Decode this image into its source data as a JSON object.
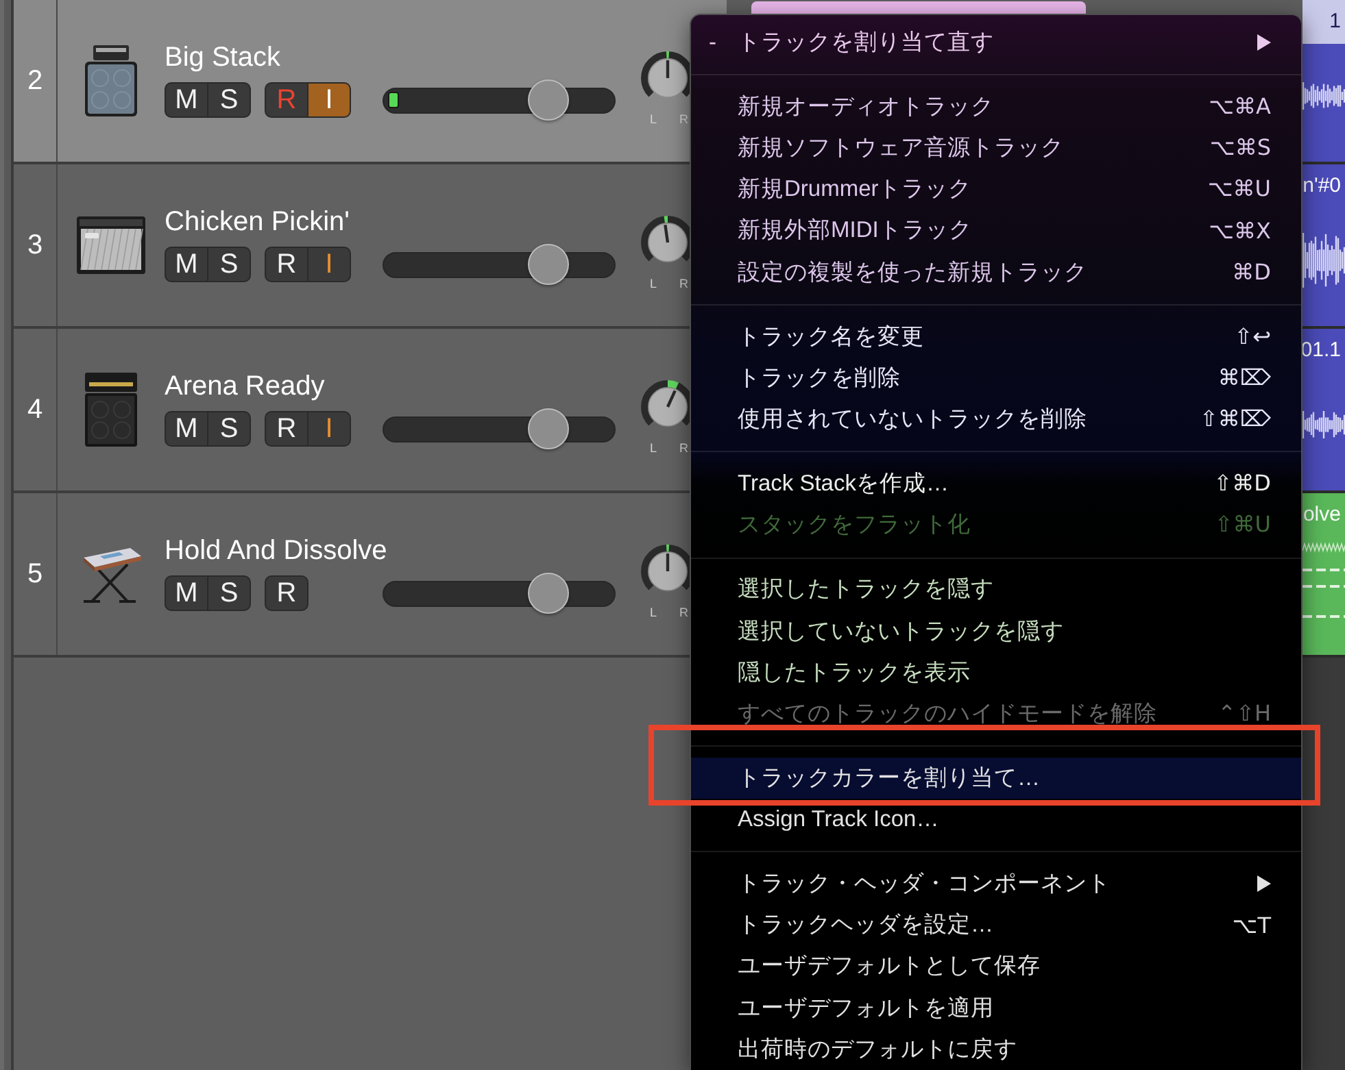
{
  "tracks": [
    {
      "number": "2",
      "name": "Big Stack",
      "kind": "stack",
      "selected": true,
      "button_groups": [
        [
          {
            "label": "M",
            "kind": "mute",
            "on": false,
            "filled": false
          },
          {
            "label": "S",
            "kind": "solo",
            "on": false,
            "filled": false
          }
        ],
        [
          {
            "label": "R",
            "kind": "record",
            "on": true,
            "filled": false
          },
          {
            "label": "I",
            "kind": "input",
            "on": true,
            "filled": true
          }
        ]
      ],
      "meter": {
        "level": 0.05
      },
      "volume": {
        "level": 0.76
      },
      "pan": {
        "level": 0.5,
        "left_label": "L",
        "right_label": "R"
      },
      "regions": [
        {
          "kind": "plain",
          "color": "#e9b6ea",
          "selected": false
        },
        {
          "kind": "audio",
          "color": "#4b4bb9",
          "selected": true,
          "title": "1"
        }
      ]
    },
    {
      "number": "3",
      "name": "Chicken Pickin'",
      "kind": "combo",
      "selected": false,
      "button_groups": [
        [
          {
            "label": "M",
            "kind": "mute",
            "on": false,
            "filled": false
          },
          {
            "label": "S",
            "kind": "solo",
            "on": false,
            "filled": false
          }
        ],
        [
          {
            "label": "R",
            "kind": "record",
            "on": false,
            "filled": false
          },
          {
            "label": "I",
            "kind": "input",
            "on": true,
            "filled": false
          }
        ]
      ],
      "volume": {
        "level": 0.76
      },
      "pan": {
        "level": 0.47,
        "left_label": "L",
        "right_label": "R"
      },
      "regions": [
        {
          "kind": "audio",
          "color": "#4b4bb9",
          "selected": false,
          "title": "n'#0"
        }
      ]
    },
    {
      "number": "4",
      "name": "Arena Ready",
      "kind": "fullstack",
      "selected": false,
      "button_groups": [
        [
          {
            "label": "M",
            "kind": "mute",
            "on": false,
            "filled": false
          },
          {
            "label": "S",
            "kind": "solo",
            "on": false,
            "filled": false
          }
        ],
        [
          {
            "label": "R",
            "kind": "record",
            "on": false,
            "filled": false
          },
          {
            "label": "I",
            "kind": "input",
            "on": true,
            "filled": false
          }
        ]
      ],
      "volume": {
        "level": 0.76
      },
      "pan": {
        "level": 0.59,
        "left_label": "L",
        "right_label": "R"
      },
      "regions": [
        {
          "kind": "audio",
          "color": "#4b4bb9",
          "selected": false,
          "title": "01.1"
        }
      ]
    },
    {
      "number": "5",
      "name": "Hold And Dissolve",
      "kind": "keyboard",
      "selected": false,
      "button_groups": [
        [
          {
            "label": "M",
            "kind": "mute",
            "on": false,
            "filled": false
          },
          {
            "label": "S",
            "kind": "solo",
            "on": false,
            "filled": false
          }
        ],
        [
          {
            "label": "R",
            "kind": "record",
            "on": false,
            "filled": false
          }
        ]
      ],
      "volume": {
        "level": 0.76
      },
      "pan": {
        "level": 0.5,
        "left_label": "L",
        "right_label": "R"
      },
      "regions": [
        {
          "kind": "midi",
          "color": "#5ab85a",
          "selected": false,
          "title": "olve"
        }
      ]
    }
  ],
  "menu": {
    "sections": [
      {
        "items": [
          {
            "label": "トラックを割り当て直す",
            "mark": "-",
            "kind": "submenu",
            "disabled": false,
            "selected": false
          }
        ]
      },
      {
        "items": [
          {
            "label": "新規オーディオトラック",
            "shortcut": "⌥⌘A",
            "kind": "command",
            "disabled": false,
            "selected": false
          },
          {
            "label": "新規ソフトウェア音源トラック",
            "shortcut": "⌥⌘S",
            "kind": "command",
            "disabled": false,
            "selected": false
          },
          {
            "label": "新規Drummerトラック",
            "shortcut": "⌥⌘U",
            "kind": "command",
            "disabled": false,
            "selected": false
          },
          {
            "label": "新規外部MIDIトラック",
            "shortcut": "⌥⌘X",
            "kind": "command",
            "disabled": false,
            "selected": false
          },
          {
            "label": "設定の複製を使った新規トラック",
            "shortcut": "⌘D",
            "kind": "command",
            "disabled": false,
            "selected": false
          }
        ]
      },
      {
        "items": [
          {
            "label": "トラック名を変更",
            "shortcut": "⇧↩",
            "kind": "command",
            "disabled": false,
            "selected": false
          },
          {
            "label": "トラックを削除",
            "shortcut": "⌘⌦",
            "kind": "command",
            "disabled": false,
            "selected": false
          },
          {
            "label": "使用されていないトラックを削除",
            "shortcut": "⇧⌘⌦",
            "kind": "command",
            "disabled": false,
            "selected": false
          }
        ]
      },
      {
        "items": [
          {
            "label": "Track Stackを作成…",
            "shortcut": "⇧⌘D",
            "kind": "command",
            "disabled": false,
            "selected": false
          },
          {
            "label": "スタックをフラット化",
            "shortcut": "⇧⌘U",
            "kind": "command",
            "disabled": true,
            "selected": false
          }
        ]
      },
      {
        "items": [
          {
            "label": "選択したトラックを隠す",
            "kind": "command",
            "disabled": false,
            "selected": false
          },
          {
            "label": "選択していないトラックを隠す",
            "kind": "command",
            "disabled": false,
            "selected": false
          },
          {
            "label": "隠したトラックを表示",
            "kind": "command",
            "disabled": false,
            "selected": false
          },
          {
            "label": "すべてのトラックのハイドモードを解除",
            "shortcut": "⌃⇧H",
            "kind": "command",
            "disabled": true,
            "selected": false
          }
        ]
      },
      {
        "items": [
          {
            "label": "トラックカラーを割り当て…",
            "kind": "command",
            "disabled": false,
            "selected": true
          },
          {
            "label": "Assign Track Icon…",
            "kind": "command",
            "disabled": false,
            "selected": false
          }
        ]
      },
      {
        "items": [
          {
            "label": "トラック・ヘッダ・コンポーネント",
            "kind": "submenu",
            "disabled": false,
            "selected": false
          },
          {
            "label": "トラックヘッダを設定…",
            "shortcut": "⌥T",
            "kind": "command",
            "disabled": false,
            "selected": false
          },
          {
            "label": "ユーザデフォルトとして保存",
            "kind": "command",
            "disabled": false,
            "selected": false
          },
          {
            "label": "ユーザデフォルトを適用",
            "kind": "command",
            "disabled": false,
            "selected": false
          },
          {
            "label": "出荷時のデフォルトに戻す",
            "kind": "command",
            "disabled": false,
            "selected": false
          }
        ]
      }
    ]
  },
  "annotation": {
    "kind": "frame"
  }
}
